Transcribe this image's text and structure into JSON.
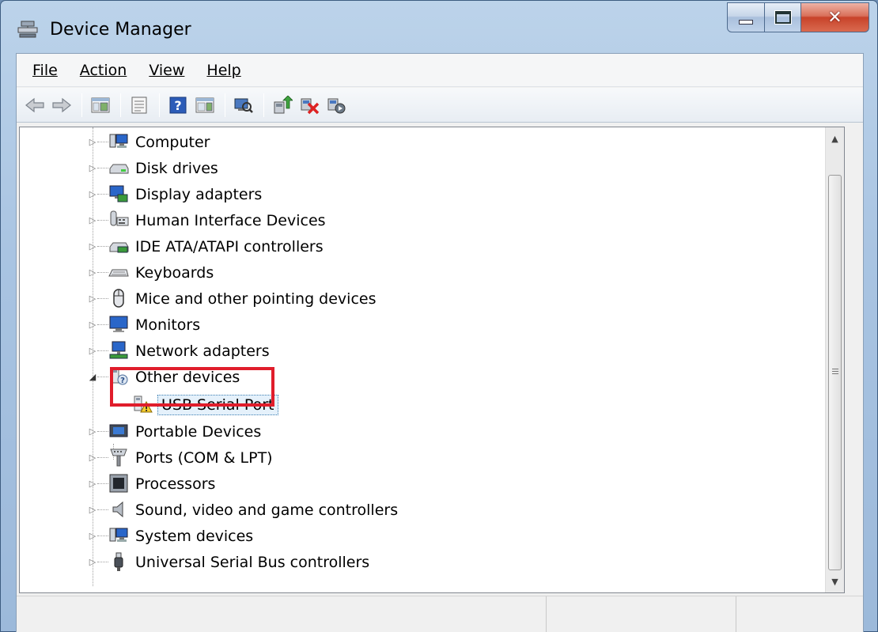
{
  "window": {
    "title": "Device Manager"
  },
  "menu": [
    {
      "label": "File"
    },
    {
      "label": "Action"
    },
    {
      "label": "View"
    },
    {
      "label": "Help"
    }
  ],
  "toolbar": {
    "buttons": [
      "back-arrow-icon",
      "forward-arrow-icon",
      "show-hide-console-tree-icon",
      "properties-icon",
      "help-icon",
      "action-pane-icon",
      "scan-hardware-icon",
      "update-driver-icon",
      "uninstall-device-icon",
      "enable-device-icon"
    ]
  },
  "tree": {
    "items": [
      {
        "label": "Computer",
        "icon": "computer-icon",
        "expanded": false
      },
      {
        "label": "Disk drives",
        "icon": "disk-drive-icon",
        "expanded": false
      },
      {
        "label": "Display adapters",
        "icon": "display-adapter-icon",
        "expanded": false
      },
      {
        "label": "Human Interface Devices",
        "icon": "hid-icon",
        "expanded": false
      },
      {
        "label": "IDE ATA/ATAPI controllers",
        "icon": "ide-controller-icon",
        "expanded": false
      },
      {
        "label": "Keyboards",
        "icon": "keyboard-icon",
        "expanded": false
      },
      {
        "label": "Mice and other pointing devices",
        "icon": "mouse-icon",
        "expanded": false
      },
      {
        "label": "Monitors",
        "icon": "monitor-icon",
        "expanded": false
      },
      {
        "label": "Network adapters",
        "icon": "network-adapter-icon",
        "expanded": false
      },
      {
        "label": "Other devices",
        "icon": "unknown-device-icon",
        "expanded": true
      },
      {
        "label": "USB Serial Port",
        "icon": "warning-device-icon",
        "child": true,
        "selected": true
      },
      {
        "label": "Portable Devices",
        "icon": "portable-device-icon",
        "expanded": false
      },
      {
        "label": "Ports (COM & LPT)",
        "icon": "port-icon",
        "expanded": false
      },
      {
        "label": "Processors",
        "icon": "processor-icon",
        "expanded": false
      },
      {
        "label": "Sound, video and game controllers",
        "icon": "speaker-icon",
        "expanded": false
      },
      {
        "label": "System devices",
        "icon": "system-device-icon",
        "expanded": false
      },
      {
        "label": "Universal Serial Bus controllers",
        "icon": "usb-icon",
        "expanded": false
      }
    ]
  },
  "colors": {
    "highlight_box": "#e01d2b",
    "title_bar": "#a9c4e2"
  }
}
